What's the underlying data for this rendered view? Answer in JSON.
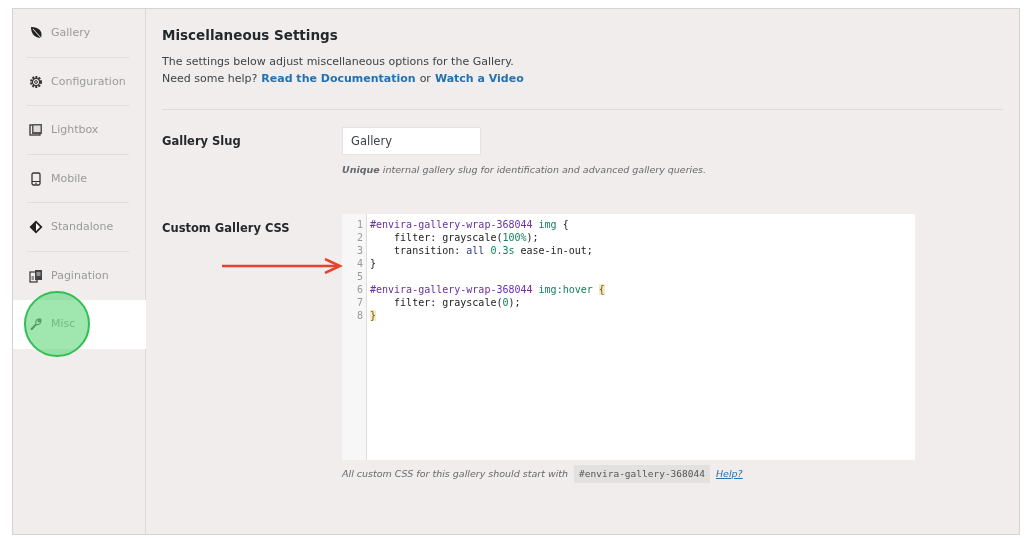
{
  "sidebar": {
    "items": [
      {
        "label": "Gallery",
        "selected": false
      },
      {
        "label": "Configuration",
        "selected": false
      },
      {
        "label": "Lightbox",
        "selected": false
      },
      {
        "label": "Mobile",
        "selected": false
      },
      {
        "label": "Standalone",
        "selected": false
      },
      {
        "label": "Pagination",
        "selected": false
      },
      {
        "label": "Misc",
        "selected": true
      }
    ]
  },
  "header": {
    "title": "Miscellaneous Settings",
    "description": "The settings below adjust miscellaneous options for the Gallery.",
    "help_prefix": "Need some help?",
    "doc_link": "Read the Documentation",
    "or": "or",
    "video_link": "Watch a Video"
  },
  "gallery_slug": {
    "label": "Gallery Slug",
    "value": "Gallery",
    "hint": "**Unique** internal gallery slug for identification and advanced gallery queries."
  },
  "custom_css": {
    "label": "Custom Gallery CSS",
    "lines": [
      {
        "number": "1",
        "tokens": [
          {
            "kind": "selector",
            "text": "#envira-gallery-wrap-368044"
          },
          {
            "kind": "tag",
            "text": " img"
          },
          {
            "kind": "plain",
            "text": " {"
          }
        ]
      },
      {
        "number": "2",
        "tokens": [
          {
            "kind": "plain",
            "text": "    filter: grayscale("
          },
          {
            "kind": "number",
            "text": "100%"
          },
          {
            "kind": "plain",
            "text": ");"
          }
        ]
      },
      {
        "number": "3",
        "tokens": [
          {
            "kind": "plain",
            "text": "    transition: "
          },
          {
            "kind": "keyword",
            "text": "all"
          },
          {
            "kind": "number",
            "text": " 0.3s"
          },
          {
            "kind": "plain",
            "text": " ease-in-out;"
          }
        ]
      },
      {
        "number": "4",
        "tokens": [
          {
            "kind": "plain",
            "text": "}"
          }
        ]
      },
      {
        "number": "5"
      },
      {
        "number": "6",
        "tokens": [
          {
            "kind": "selector",
            "text": "#envira-gallery-wrap-368044"
          },
          {
            "kind": "tag",
            "text": " img:hover "
          },
          {
            "kind": "bracket",
            "text": "{"
          }
        ]
      },
      {
        "number": "7",
        "tokens": [
          {
            "kind": "plain",
            "text": "    filter: grayscale("
          },
          {
            "kind": "number",
            "text": "0"
          },
          {
            "kind": "plain",
            "text": ");"
          }
        ]
      },
      {
        "number": "8",
        "tokens": [
          {
            "kind": "bracket",
            "text": "}"
          }
        ]
      }
    ],
    "footer_text": "All custom CSS for this gallery should start with",
    "footer_code": "#envira-gallery-368044",
    "footer_link": "Help?"
  }
}
